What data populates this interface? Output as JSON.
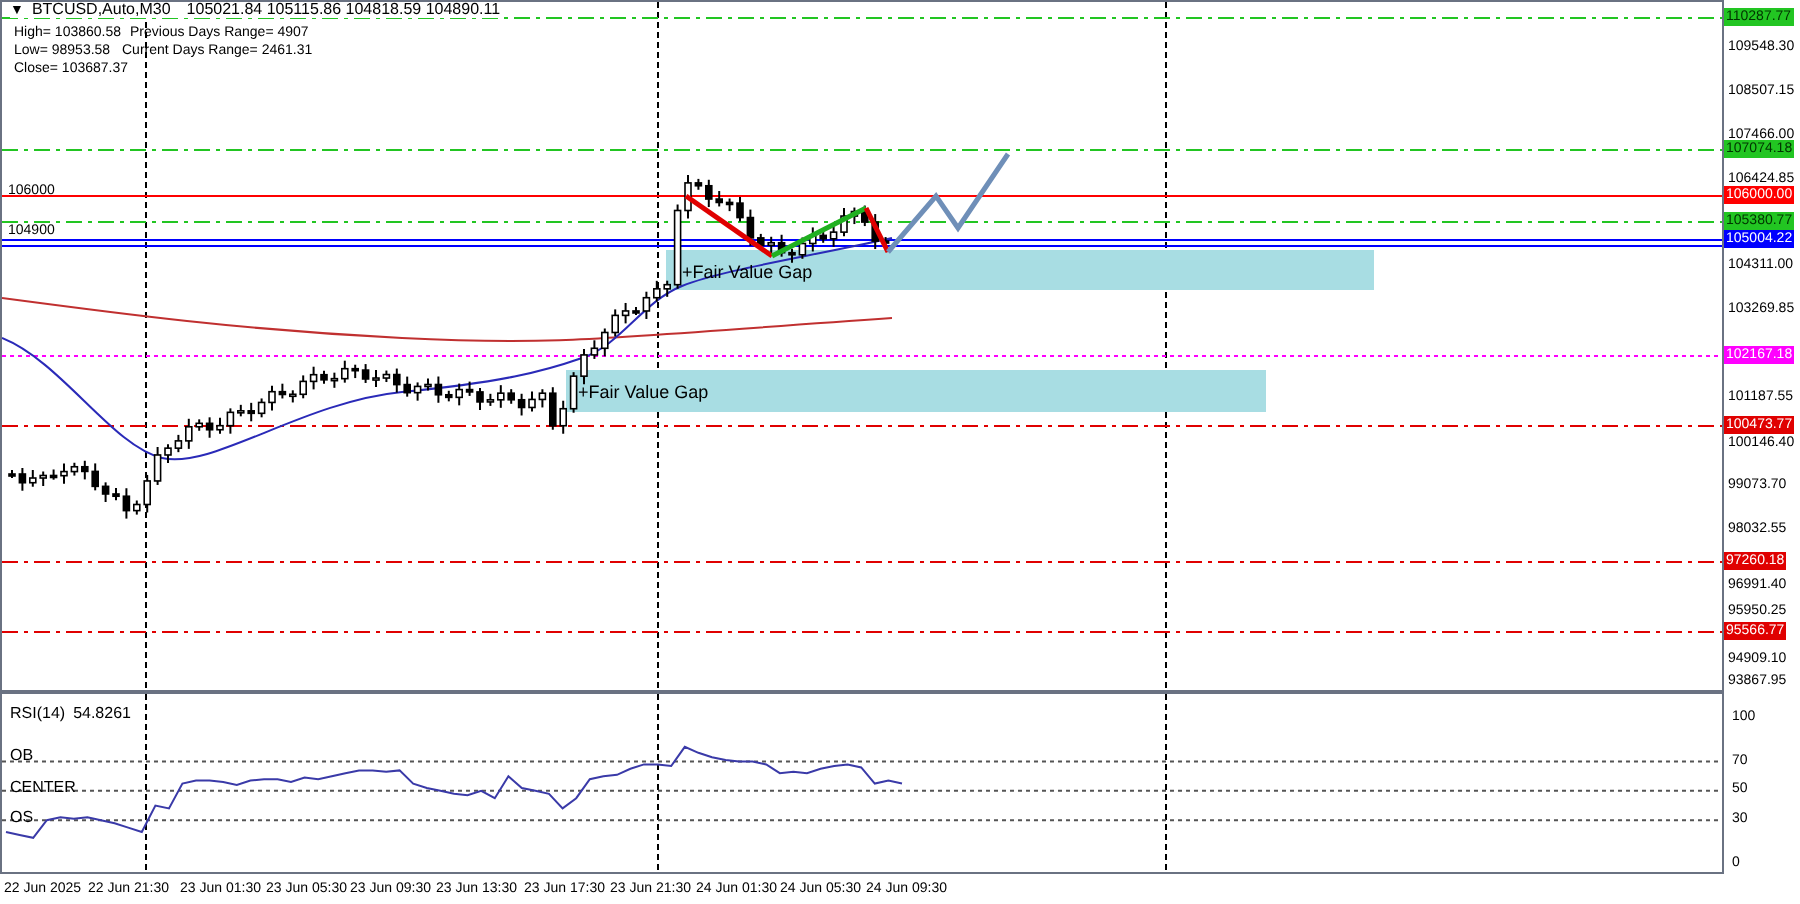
{
  "header": {
    "menu_glyph": "▼",
    "symbol": "BTCUSD,Auto,M30",
    "quote": "105021.84 105115.86 104818.59 104890.11"
  },
  "info": [
    {
      "label": "High= 103860.58"
    },
    {
      "label": "Previous Days Range= 4907"
    },
    {
      "label": "Low= 98953.58"
    },
    {
      "label": "Current Days Range= 2461.31"
    },
    {
      "label": "Close= 103687.37"
    }
  ],
  "price_axis": [
    "109548.30",
    "108507.15",
    "107466.00",
    "106424.85",
    "104311.00",
    "103269.85",
    "101187.55",
    "100146.40",
    "99073.70",
    "98032.55",
    "96991.40",
    "95950.25",
    "94909.10",
    "93867.95"
  ],
  "levels": [
    {
      "label": "110287.77",
      "color": "#22c522",
      "kind": "dashdot"
    },
    {
      "label": "107074.18",
      "color": "#22c522",
      "kind": "dashdot"
    },
    {
      "label": "106000.00",
      "color": "#ff0000",
      "kind": "solid"
    },
    {
      "label": "105380.77",
      "color": "#22c522",
      "kind": "dashdot"
    },
    {
      "label": "105004.22",
      "color": "#0000ff",
      "kind": "double"
    },
    {
      "label": "102167.18",
      "color": "#ff00ff",
      "kind": "dotted"
    },
    {
      "label": "100473.77",
      "color": "#e00000",
      "kind": "dashdot"
    },
    {
      "label": "97260.18",
      "color": "#e00000",
      "kind": "dashdot"
    },
    {
      "label": "95566.77",
      "color": "#e00000",
      "kind": "dashdot"
    }
  ],
  "line_labels": [
    "106000",
    "104900"
  ],
  "zones": [
    {
      "label": "+Fair Value Gap"
    },
    {
      "label": "+Fair Value Gap"
    }
  ],
  "rsi": {
    "value": "54.8261",
    "levels": [
      "OB",
      "CENTER",
      "OS"
    ],
    "chart_data": {
      "type": "line",
      "grid": true,
      "ylim": [
        -8,
        116
      ],
      "yticks": [
        0,
        30,
        50,
        70,
        100
      ],
      "series": [
        {
          "name": "RSI(14)",
          "color": "#3a3aa8",
          "values": [
            22,
            20,
            18,
            30,
            32,
            31,
            32,
            30,
            28,
            25,
            22,
            40,
            38,
            55,
            57,
            57,
            56,
            54,
            57,
            58,
            58,
            56,
            59,
            58,
            60,
            62,
            64,
            64,
            63,
            64,
            55,
            52,
            50,
            48,
            47,
            50,
            45,
            60,
            52,
            50,
            48,
            38,
            45,
            58,
            60,
            61,
            65,
            68,
            68,
            67,
            80,
            76,
            73,
            71,
            70,
            70,
            68,
            62,
            63,
            62,
            65,
            67,
            68,
            66,
            55,
            57,
            55
          ]
        }
      ]
    }
  },
  "time_axis": [
    "22 Jun 2025",
    "22 Jun 21:30",
    "23 Jun 01:30",
    "23 Jun 05:30",
    "23 Jun 09:30",
    "23 Jun 13:30",
    "23 Jun 17:30",
    "23 Jun 21:30",
    "24 Jun 01:30",
    "24 Jun 05:30",
    "24 Jun 09:30"
  ]
}
